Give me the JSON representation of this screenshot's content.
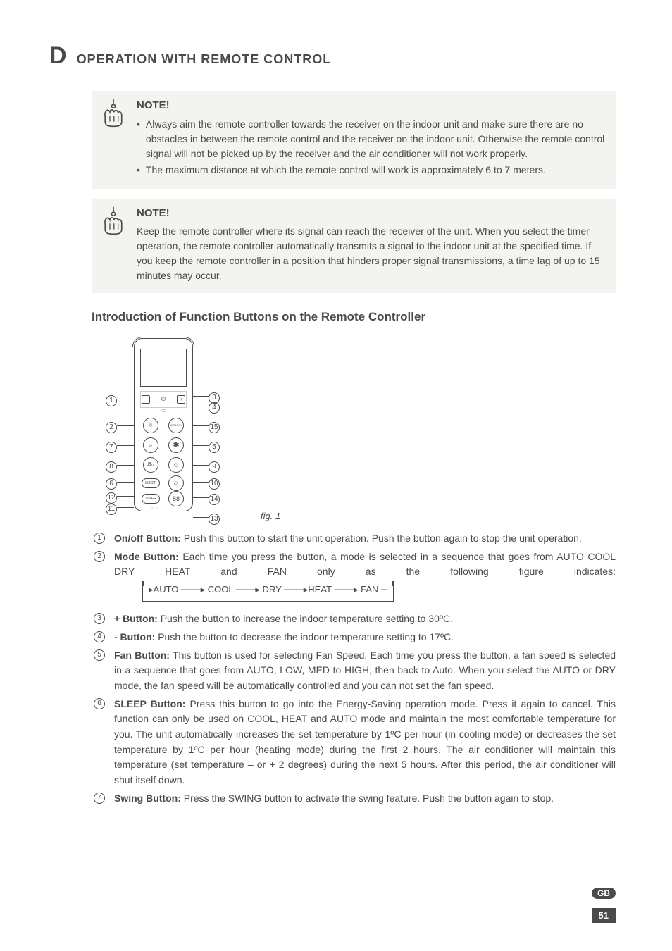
{
  "section": {
    "letter": "D",
    "title": "OPERATION WITH REMOTE CONTROL"
  },
  "note1": {
    "heading": "NOTE!",
    "bullets": [
      "Always aim the remote controller towards the receiver on the indoor unit and make sure there are no obstacles in between the remote control and the receiver on the indoor unit. Otherwise the remote control signal will not be picked up by the receiver and the air conditioner will not work properly.",
      "The maximum distance at which the remote control will work is approximately 6 to 7 meters."
    ]
  },
  "note2": {
    "heading": "NOTE!",
    "body": "Keep the remote controller where its signal can reach the receiver of the unit. When you select the timer operation, the remote controller automatically transmits a signal to the indoor unit at the specified time. If you keep the remote controller in a position that hinders proper signal transmissions, a time lag of up to 15 minutes may occur."
  },
  "intro_heading": "Introduction of Function Buttons on the Remote Controller",
  "figure": {
    "caption": "fig. 1",
    "callouts": [
      "1",
      "2",
      "3",
      "4",
      "5",
      "6",
      "7",
      "8",
      "9",
      "10",
      "11",
      "12",
      "13",
      "14",
      "15"
    ]
  },
  "remote_labels": {
    "temp_unit": "°C",
    "memory": "MEMORY",
    "sleep": "SLEEP",
    "timer": "TIMER",
    "digits": "88"
  },
  "mode_flow": "▸AUTO ───▸ COOL ───▸ DRY ───▸HEAT ───▸ FAN ─",
  "items": [
    {
      "n": "1",
      "title": "On/off Button:",
      "body": "Push this button to start the unit operation. Push the button again to stop the unit operation."
    },
    {
      "n": "2",
      "title": "Mode Button:",
      "body": "Each time you press the button, a mode is selected in a sequence that goes from AUTO COOL DRY HEAT and FAN only as the following figure indicates:"
    },
    {
      "n": "3",
      "title": "+ Button:",
      "body": "Push the button to increase the indoor temperature setting to 30ºC."
    },
    {
      "n": "4",
      "title": "- Button:",
      "body": "Push the button to decrease the indoor temperature setting to 17ºC."
    },
    {
      "n": "5",
      "title": "Fan Button:",
      "body": "This button is used for selecting Fan Speed. Each time you press the button, a fan speed is selected in a sequence that goes from AUTO, LOW, MED to HIGH, then back to Auto. When you select the AUTO or DRY mode, the fan speed will be automatically controlled and you can not set the fan speed."
    },
    {
      "n": "6",
      "title": "SLEEP Button:",
      "body": "Press this button to go into the Energy-Saving operation mode. Press it again to cancel. This function can only be used on COOL, HEAT and AUTO mode and maintain the most comfortable temperature for you. The unit automatically increases the set temperature by 1ºC per hour (in cooling mode) or decreases the set temperature by 1ºC per hour (heating mode) during the first 2 hours. The air conditioner will maintain this temperature (set temperature – or + 2 degrees) during the next 5 hours. After this period, the air conditioner will shut itself down."
    },
    {
      "n": "7",
      "title": "Swing Button:",
      "body": "Press the SWING button to activate the swing feature. Push the button again to stop."
    }
  ],
  "footer": {
    "lang": "GB",
    "page": "51"
  }
}
